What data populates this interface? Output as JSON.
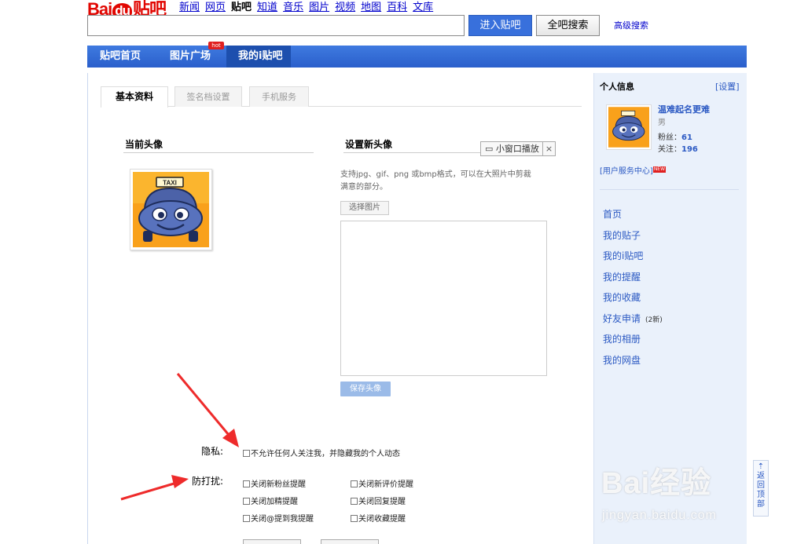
{
  "header": {
    "logo_bai": "Bai",
    "logo_du": "du",
    "logo_tieba": "贴吧",
    "nav": [
      "新闻",
      "网页",
      "贴吧",
      "知道",
      "音乐",
      "图片",
      "视频",
      "地图",
      "百科",
      "文库"
    ],
    "nav_current": "贴吧",
    "search_value": "",
    "enter_button": "进入贴吧",
    "all_search_button": "全吧搜索",
    "advanced_search": "高级搜索"
  },
  "navbar": {
    "items": [
      "贴吧首页",
      "图片广场",
      "我的i贴吧"
    ],
    "active": "我的i贴吧",
    "hot_badge": "hot"
  },
  "tabs": [
    "基本资料",
    "签名档设置",
    "手机服务"
  ],
  "tabs_active": "基本资料",
  "avatar": {
    "current_title": "当前头像",
    "new_title": "设置新头像",
    "taxi_sign": "TAXI",
    "hint": "支持jpg、gif、png 或bmp格式，可以在大照片中剪裁满意的部分。",
    "choose_button": "选择图片",
    "save_button": "保存头像",
    "popup_label": "小窗口播放",
    "popup_close": "×"
  },
  "privacy": {
    "label": "隐私:",
    "option": "不允许任何人关注我，并隐藏我的个人动态",
    "checked": false
  },
  "dnd": {
    "label": "防打扰:",
    "options": [
      "关闭新粉丝提醒",
      "关闭新评价提醒",
      "关闭加精提醒",
      "关闭回复提醒",
      "关闭@提到我提醒",
      "关闭收藏提醒"
    ]
  },
  "sidebar": {
    "title": "个人信息",
    "settings_link": "[设置]",
    "username": "温难起名更难",
    "gender": "男",
    "fans_label": "粉丝：",
    "fans": "61",
    "follow_label": "关注：",
    "follow": "196",
    "service_center": "[用户服务中心]",
    "new_badge": "NEW",
    "links": [
      "首页",
      "我的贴子",
      "我的i贴吧",
      "我的提醒",
      "我的收藏",
      "好友申请",
      "我的相册",
      "我的网盘"
    ],
    "friend_request_count": "(2新)"
  },
  "back_to_top": "返回顶部",
  "watermark": {
    "main": "Bai经验",
    "sub": "jingyan.baidu.com"
  },
  "colors": {
    "nav_blue": "#2a5fcb",
    "link_blue": "#2b59c3",
    "annotation_red": "#ee2b2b"
  }
}
